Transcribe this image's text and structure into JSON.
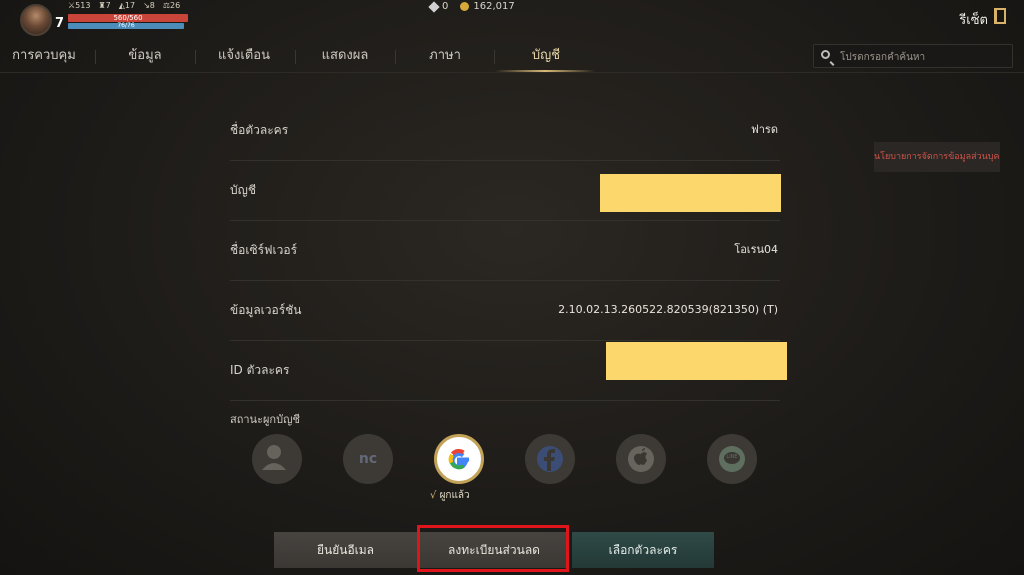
{
  "hud": {
    "level": "7",
    "stats": [
      "513",
      "7",
      "17",
      "8",
      "26"
    ],
    "hp": "560/560",
    "mp": "76/76",
    "gems": "0",
    "gold": "162,017",
    "reset_label": "รีเซ็ต"
  },
  "tabs": [
    "การควบคุม",
    "ข้อมูล",
    "แจ้งเตือน",
    "แสดงผล",
    "ภาษา",
    "บัญชี"
  ],
  "active_tab": "บัญชี",
  "search": {
    "placeholder": "โปรดกรอกคำค้นหา"
  },
  "privacy_link": "นโยบายการจัดการข้อมูลส่วนบุคคล",
  "rows": [
    {
      "label": "ชื่อตัวละคร",
      "value": "ฟารด"
    },
    {
      "label": "บัญชี",
      "value": ""
    },
    {
      "label": "ชื่อเซิร์ฟเวอร์",
      "value": "โอเรน04"
    },
    {
      "label": "ข้อมูลเวอร์ชัน",
      "value": "2.10.02.13.260522.820539(821350) (T)"
    },
    {
      "label": "ID ตัวละคร",
      "value": ""
    }
  ],
  "binding": {
    "label": "สถานะผูกบัญชี",
    "providers": [
      "guest",
      "ncsoft",
      "google",
      "facebook",
      "apple",
      "line"
    ],
    "provider_text": {
      "ncsoft": "nc",
      "line": "LINE"
    },
    "bound_provider": "google",
    "bound_text": "ผูกแล้ว",
    "check_mark": "√"
  },
  "buttons": {
    "verify_email": "ยืนยันอีเมล",
    "pre_register": "ลงทะเบียนส่วนลด",
    "select_character": "เลือกตัวละคร"
  },
  "colors": {
    "highlight": "#e0151b",
    "redaction": "#fcd86c",
    "accent_gold": "#d9b978"
  }
}
